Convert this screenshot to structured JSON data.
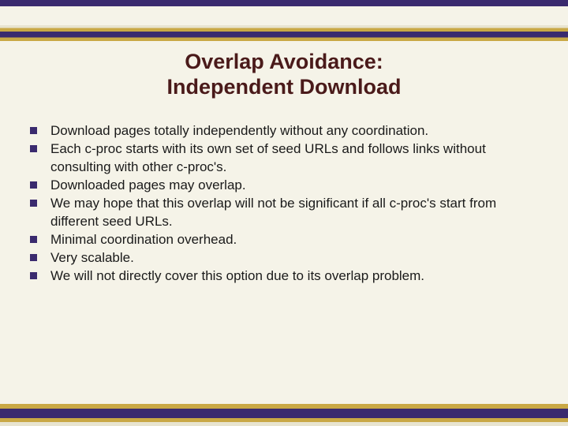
{
  "title": {
    "line1": "Overlap Avoidance:",
    "line2": "Independent Download"
  },
  "bullets": [
    "Download pages totally independently without any coordination.",
    "Each c-proc starts with its own set of seed URLs and follows links without consulting with other c-proc's.",
    "Downloaded pages may overlap.",
    "We may hope that this overlap will not be significant if all c-proc's start from different seed URLs.",
    "Minimal coordination overhead.",
    "Very scalable.",
    "We will not directly cover this option due to its overlap problem."
  ]
}
